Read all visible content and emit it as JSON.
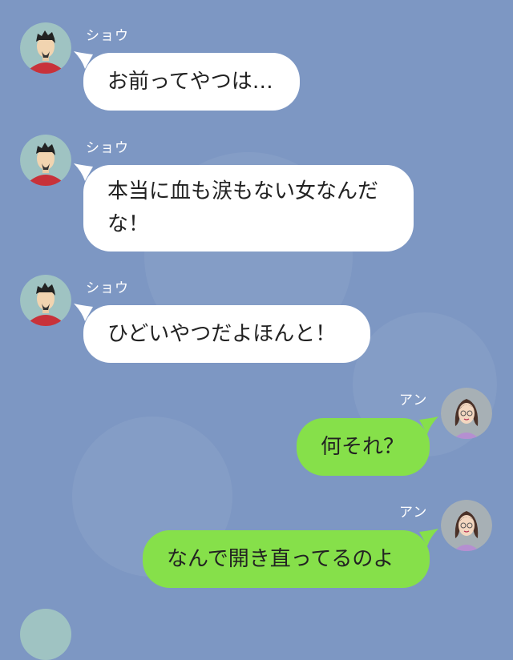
{
  "messages": [
    {
      "sender": "ショウ",
      "text": "お前ってやつは…",
      "side": "left"
    },
    {
      "sender": "ショウ",
      "text": "本当に血も涙もない女なんだな！",
      "side": "left"
    },
    {
      "sender": "ショウ",
      "text": "ひどいやつだよほんと！",
      "side": "left"
    },
    {
      "sender": "アン",
      "text": "何それ？",
      "side": "right"
    },
    {
      "sender": "アン",
      "text": "なんで開き直ってるのよ",
      "side": "right"
    }
  ],
  "colors": {
    "background": "#7d97c3",
    "incoming_bubble": "#ffffff",
    "outgoing_bubble": "#86e04a"
  },
  "icons": {
    "sho_avatar": "man-avatar-icon",
    "an_avatar": "woman-avatar-icon"
  }
}
